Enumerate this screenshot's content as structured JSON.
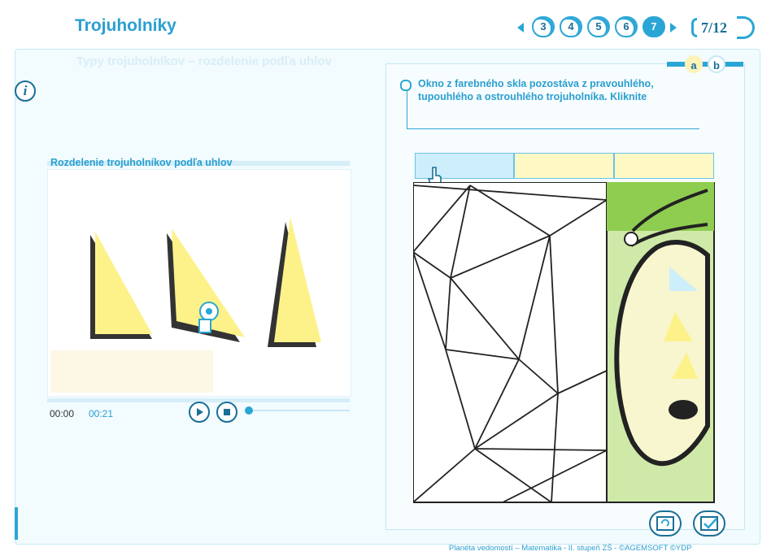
{
  "app": {
    "title": "Trojuholníky",
    "section_heading": "Typy trojuholníkov – rozdelenie podľa uhlov"
  },
  "navigation": {
    "pages": [
      "3",
      "4",
      "5",
      "6",
      "7"
    ],
    "active_page": "7",
    "counter": "7/12"
  },
  "info_button": {
    "label": "i"
  },
  "video": {
    "title": "Rozdelenie trojuholníkov podľa uhlov",
    "time_elapsed": "00:00",
    "time_total": "00:21"
  },
  "exercise": {
    "tabs": [
      "a",
      "b"
    ],
    "active_tab": "a",
    "instruction": "Okno z farebného skla pozostáva z pravouhlého, tupouhlého a ostrouhlého trojuholníka. Kliknite"
  },
  "footer": "Planéta vedomostí – Matematika - II. stupeň ZŠ - ©AGEMSOFT ©YDP",
  "colors": {
    "accent": "#2aa6d6",
    "dark_accent": "#1a6f98",
    "triangle_fill": "#fdf28a",
    "slot_blue": "#cdeefb",
    "slot_yellow": "#fdf8c4",
    "green_panel": "#cfe9a8"
  }
}
